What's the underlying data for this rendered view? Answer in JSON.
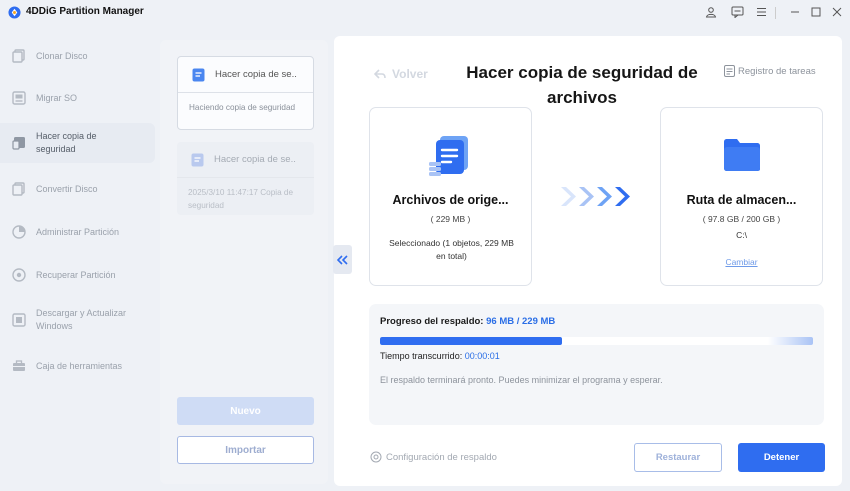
{
  "app": {
    "title": "4DDiG Partition Manager"
  },
  "window_controls": [
    "user-icon",
    "feedback-icon",
    "menu-icon",
    "minimize-icon",
    "maximize-icon",
    "close-icon"
  ],
  "sidebar": {
    "items": [
      {
        "label": "Clonar Disco",
        "icon": "clone-disk-icon",
        "active": false
      },
      {
        "label": "Migrar SO",
        "icon": "migrate-os-icon",
        "active": false
      },
      {
        "label": "Hacer copia de seguridad",
        "icon": "backup-icon",
        "active": true
      },
      {
        "label": "Convertir Disco",
        "icon": "convert-disk-icon",
        "active": false
      },
      {
        "label": "Administrar Partición",
        "icon": "partition-icon",
        "active": false
      },
      {
        "label": "Recuperar Partición",
        "icon": "recover-partition-icon",
        "active": false
      },
      {
        "label": "Descargar y Actualizar Windows",
        "icon": "download-windows-icon",
        "active": false
      },
      {
        "label": "Caja de herramientas",
        "icon": "toolbox-icon",
        "active": false
      }
    ]
  },
  "tasks": [
    {
      "title": "Hacer copia de se..",
      "subtitle": "Haciendo copia de seguridad",
      "active": true
    },
    {
      "title": "Hacer copia de se..",
      "subtitle": "2025/3/10 11:47:17 Copia de seguridad",
      "active": false
    }
  ],
  "task_panel": {
    "new_label": "Nuevo",
    "import_label": "Importar"
  },
  "main": {
    "back_label": "Volver",
    "title": "Hacer copia de seguridad de archivos",
    "task_log_label": "Registro de tareas",
    "source": {
      "title": "Archivos de orige...",
      "size": "( 229 MB )",
      "detail": "Seleccionado (1 objetos, 229 MB en total)"
    },
    "destination": {
      "title": "Ruta de almacen...",
      "size": "( 97.8 GB / 200 GB )",
      "drive": "C:\\",
      "change_label": "Cambiar"
    },
    "progress": {
      "label": "Progreso del respaldo:",
      "value": "96 MB / 229 MB",
      "fraction": 0.42,
      "elapsed_label": "Tiempo transcurrido:",
      "elapsed_value": "00:00:01",
      "note": "El respaldo terminará pronto. Puedes minimizar el programa y esperar."
    },
    "backup_config_label": "Configuración de respaldo",
    "restore_label": "Restaurar",
    "stop_label": "Detener"
  },
  "colors": {
    "accent": "#2f6df0",
    "accent_light": "#cfdcf5",
    "background": "#eef1f6"
  }
}
